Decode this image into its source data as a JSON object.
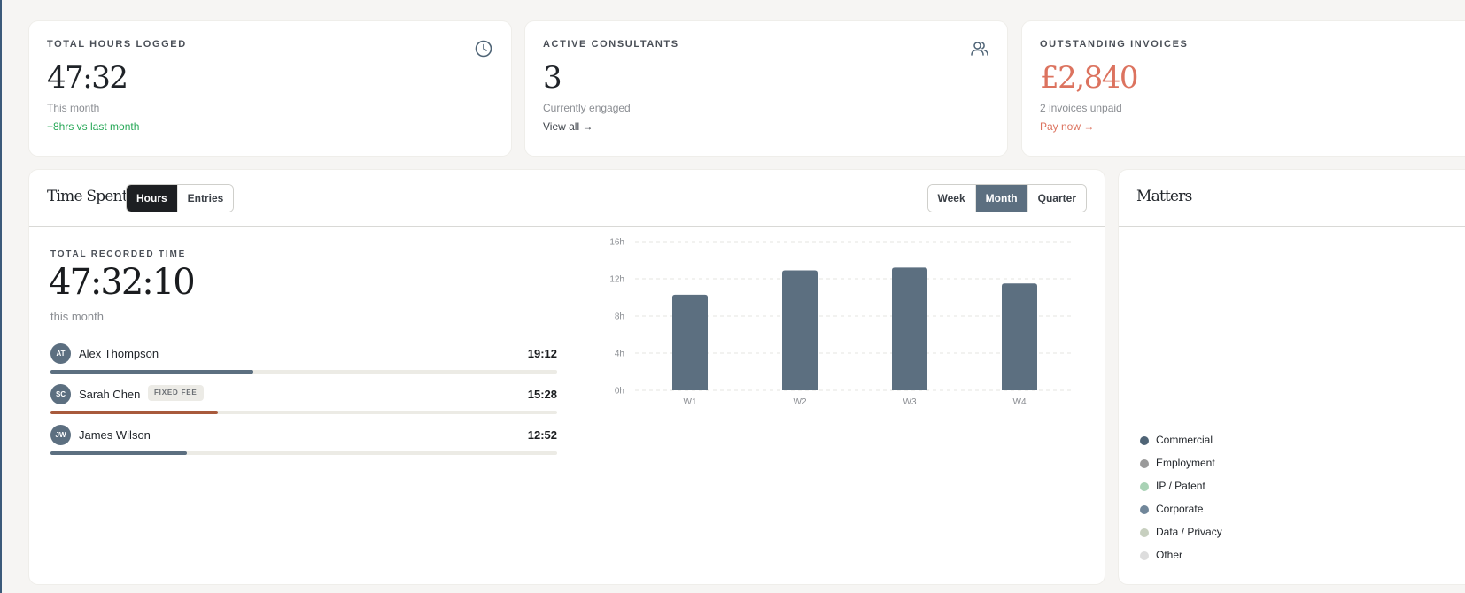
{
  "stats": [
    {
      "label": "TOTAL HOURS LOGGED",
      "value": "47:32",
      "sub": "This month",
      "note": "+8hrs vs last month",
      "icon": "clock-icon"
    },
    {
      "label": "ACTIVE CONSULTANTS",
      "value": "3",
      "sub": "Currently engaged",
      "note": "View all →",
      "icon": "users-icon"
    },
    {
      "label": "OUTSTANDING INVOICES",
      "value": "£2,840",
      "sub": "2 invoices unpaid",
      "note": "Pay now →"
    }
  ],
  "time_panel": {
    "title": "Time Spent",
    "view_toggle": [
      "Hours",
      "Entries"
    ],
    "active_view": "Hours",
    "period_toggle": [
      "Week",
      "Month",
      "Quarter"
    ],
    "active_period": "Month",
    "total_label": "TOTAL RECORDED TIME",
    "total_value": "47:32:10",
    "total_sub": "this month",
    "people": [
      {
        "initials": "AT",
        "name": "Alex Thompson",
        "time": "19:12",
        "badge": "",
        "progress": 0.4,
        "color": "#5c6f80"
      },
      {
        "initials": "SC",
        "name": "Sarah Chen",
        "time": "15:28",
        "badge": "FIXED FEE",
        "progress": 0.33,
        "color": "#a85a3c"
      },
      {
        "initials": "JW",
        "name": "James Wilson",
        "time": "12:52",
        "badge": "",
        "progress": 0.27,
        "color": "#5c6f80"
      }
    ]
  },
  "chart_data": {
    "type": "bar",
    "categories": [
      "W1",
      "W2",
      "W3",
      "W4"
    ],
    "values": [
      10.3,
      12.9,
      13.2,
      11.5
    ],
    "ylim": [
      0,
      16
    ],
    "yticks": [
      0,
      4,
      8,
      12,
      16
    ],
    "tick_suffix": "h",
    "grid": true,
    "bar_color": "#5c6f80"
  },
  "matters_panel": {
    "title": "Matters",
    "legend": [
      {
        "label": "Commercial",
        "color": "#4f6476"
      },
      {
        "label": "Employment",
        "color": "#9a9a9a"
      },
      {
        "label": "IP / Patent",
        "color": "#a9d2b5"
      },
      {
        "label": "Corporate",
        "color": "#71879a"
      },
      {
        "label": "Data / Privacy",
        "color": "#c7cfbf"
      },
      {
        "label": "Other",
        "color": "#dddddd"
      }
    ]
  }
}
